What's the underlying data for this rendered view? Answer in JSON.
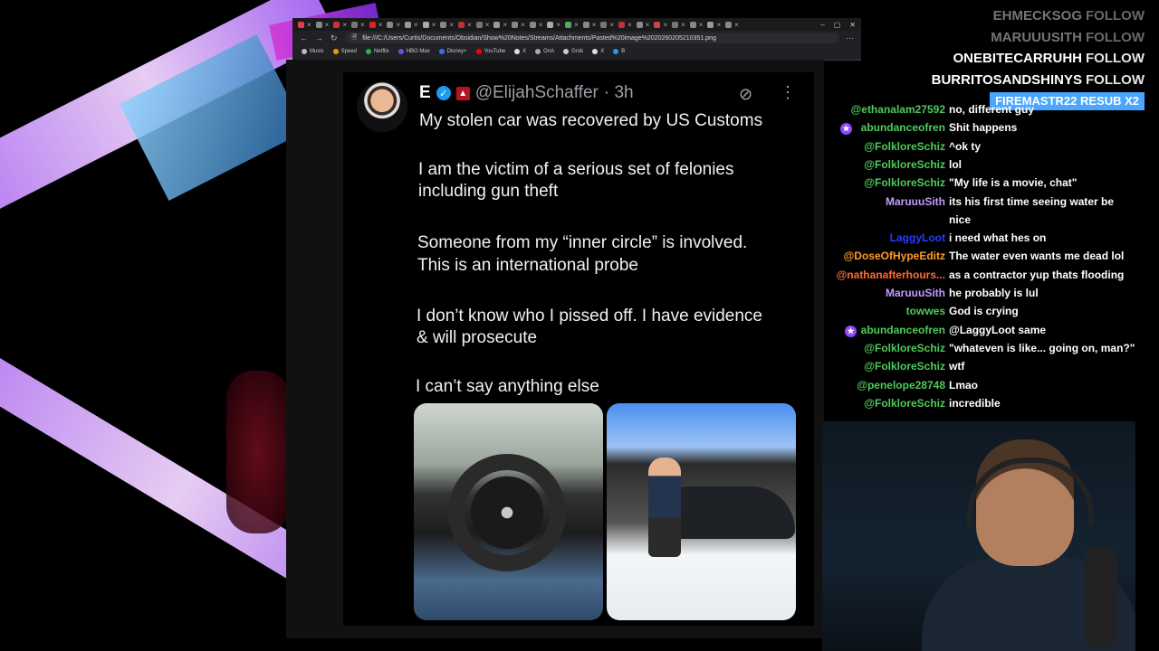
{
  "browser": {
    "url": "file:///C:/Users/Curtis/Documents/Obsidian/Show%20Notes/Streams/Attachments/Pasted%20image%2020260205210351.png",
    "bookmarks": [
      {
        "label": "Music",
        "color": "#bbbbbb"
      },
      {
        "label": "Speed",
        "color": "#f29900"
      },
      {
        "label": "Netflix",
        "color": "#27b34a"
      },
      {
        "label": "HBO Max",
        "color": "#7a4bdc"
      },
      {
        "label": "Disney+",
        "color": "#3a6ff2"
      },
      {
        "label": "YouTube",
        "color": "#ff0000"
      },
      {
        "label": "X",
        "color": "#dddddd"
      },
      {
        "label": "OnA",
        "color": "#aaaaaa"
      },
      {
        "label": "Grok",
        "color": "#cccccc"
      },
      {
        "label": "X",
        "color": "#dddddd"
      },
      {
        "label": "B",
        "color": "#1d9bf0"
      }
    ]
  },
  "tweet": {
    "avatar_letter": "E",
    "handle": "@ElijahSchaffer",
    "time": "· 3h",
    "lines": [
      "My stolen car was recovered by US Customs",
      "I am the victim of a serious set of felonies",
      "including gun theft",
      "Someone from my “inner circle” is involved.",
      "This is an international probe",
      "I don’t know who I pissed off. I have evidence",
      "& will prosecute",
      "I can’t say anything else"
    ]
  },
  "alerts": [
    {
      "user": "EHMECKSOG",
      "action": "FOLLOW"
    },
    {
      "user": "MARUUUSITH",
      "action": "FOLLOW"
    },
    {
      "user": "ONEBITECARRUHH",
      "action": "FOLLOW"
    },
    {
      "user": "BURRITOSANDSHINYS",
      "action": "FOLLOW"
    },
    {
      "user": "FIREMASTR22",
      "action": "RESUB X2"
    }
  ],
  "chat": [
    {
      "user": "@ethanalam27592",
      "text": "no, different guy",
      "color": "#4ecb5a"
    },
    {
      "user": "abundanceofren",
      "text": "Shit happens",
      "color": "#4ecb5a"
    },
    {
      "user": "@FolkloreSchiz",
      "text": "^ok ty",
      "color": "#4ecb5a"
    },
    {
      "user": "@FolkloreSchiz",
      "text": "lol",
      "color": "#4ecb5a"
    },
    {
      "user": "@FolkloreSchiz",
      "text": "\"My life is a movie, chat\"",
      "color": "#4ecb5a"
    },
    {
      "user": "MaruuuSith",
      "text": "its his first time seeing water be",
      "color": "#c49cff"
    },
    {
      "user": "",
      "text": "nice",
      "color": "#c49cff"
    },
    {
      "user": "LaggyLoot",
      "text": "i need what hes on",
      "color": "#2a3bff"
    },
    {
      "user": "@DoseOfHypeEditz",
      "text": "The water even wants me dead lol",
      "color": "#ff9c2a"
    },
    {
      "user": "@nathanafterhours...",
      "text": "as a contractor yup thats flooding",
      "color": "#ff6a33"
    },
    {
      "user": "MaruuuSith",
      "text": "he probably is lul",
      "color": "#c49cff"
    },
    {
      "user": "towwes",
      "text": "God is crying",
      "color": "#4ecb5a"
    },
    {
      "user": "abundanceofren",
      "text": "@LaggyLoot same",
      "color": "#4ecb5a"
    },
    {
      "user": "@FolkloreSchiz",
      "text": "\"whateven is like... going on, man?\"",
      "color": "#4ecb5a"
    },
    {
      "user": "@FolkloreSchiz",
      "text": "wtf",
      "color": "#4ecb5a"
    },
    {
      "user": "@penelope28748",
      "text": "Lmao",
      "color": "#4ecb5a"
    },
    {
      "user": "@FolkloreSchiz",
      "text": "incredible",
      "color": "#4ecb5a"
    }
  ]
}
